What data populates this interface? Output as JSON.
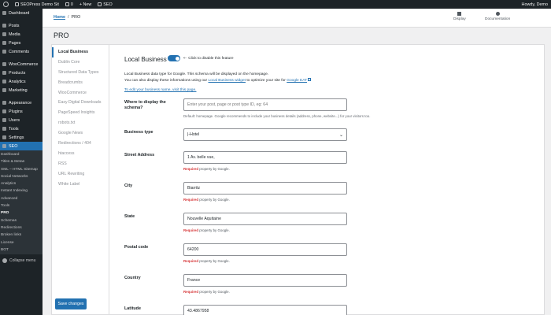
{
  "adminbar": {
    "site_name": "SEOPress Demo Sit",
    "comments_count": "0",
    "new_label": "+ New",
    "seo_label": "SEO",
    "howdy": "Howdy, Demo"
  },
  "sidebar": {
    "items": [
      {
        "label": "Dashboard",
        "icon": "dashboard-icon"
      },
      {
        "label": "Posts",
        "icon": "pin-icon"
      },
      {
        "label": "Media",
        "icon": "media-icon"
      },
      {
        "label": "Pages",
        "icon": "page-icon"
      },
      {
        "label": "Comments",
        "icon": "comment-icon"
      },
      {
        "label": "WooCommerce",
        "icon": "woo-icon"
      },
      {
        "label": "Products",
        "icon": "product-icon"
      },
      {
        "label": "Analytics",
        "icon": "chart-icon"
      },
      {
        "label": "Marketing",
        "icon": "megaphone-icon"
      },
      {
        "label": "Appearance",
        "icon": "brush-icon"
      },
      {
        "label": "Plugins",
        "icon": "plugin-icon"
      },
      {
        "label": "Users",
        "icon": "user-icon"
      },
      {
        "label": "Tools",
        "icon": "wrench-icon"
      },
      {
        "label": "Settings",
        "icon": "settings-icon"
      },
      {
        "label": "SEO",
        "icon": "seo-icon"
      }
    ],
    "submenu": [
      "Dashboard",
      "Titles & Metas",
      "XML – HTML Sitemap",
      "Social Networks",
      "Analytics",
      "Instant Indexing",
      "Advanced",
      "Tools",
      "PRO",
      "Schemas",
      "Redirections",
      "Broken links",
      "License",
      "BOT"
    ],
    "collapse_label": "Collapse menu"
  },
  "header": {
    "breadcrumb_home": "Home",
    "breadcrumb_sep": "/",
    "breadcrumb_current": "PRO",
    "display_label": "Display",
    "documentation_label": "Documentation"
  },
  "page_title": "PRO",
  "tabs": [
    "Local Business",
    "Dublin Core",
    "Structured Data Types",
    "Breadcrumbs",
    "WooCommerce",
    "Easy Digital Downloads",
    "PageSpeed Insights",
    "robots.txt",
    "Google News",
    "Redirections / 404",
    "htaccess",
    "RSS",
    "URL Rewriting",
    "White Label"
  ],
  "save_button": "Save changes",
  "section": {
    "title": "Local Business",
    "toggle_hint": "Click to disable this feature",
    "desc1": "Local Business data type for Google. This schema will be displayed on the homepage.",
    "desc2_prefix": "You can also display these informations using our",
    "desc2_link1": "Local Business widget",
    "desc2_middle": "to optimize your site for",
    "desc2_link2": "Google EAT",
    "edit_link": "To edit your business name, visit this page."
  },
  "fields": {
    "schema_label": "Where to display the schema?",
    "schema_placeholder": "Enter your post, page or post type ID, eg: 64",
    "schema_help": "Default: homepage. Google recommends to include your business details (address, phone, website...) for your visitors too.",
    "business_type_label": "Business type",
    "business_type_value": "|-Hotel",
    "street_label": "Street Address",
    "street_value": "1 Av. belle vue,",
    "city_label": "City",
    "city_value": "Biarritz",
    "state_label": "State",
    "state_value": "Nouvelle Aquitaine",
    "postal_label": "Postal code",
    "postal_value": "64200",
    "country_label": "Country",
    "country_value": "France",
    "latitude_label": "Latitude",
    "latitude_value": "43.4867958",
    "required_word": "Required",
    "required_rest": "property by Google."
  },
  "colors": {
    "accent": "#2271b1",
    "admin_dark": "#1d2327",
    "required_red": "#d63638"
  }
}
